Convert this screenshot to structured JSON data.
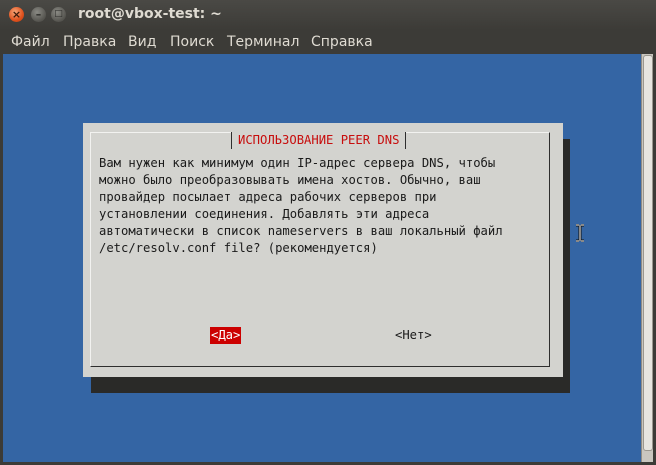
{
  "window": {
    "title": "root@vbox-test: ~",
    "controls": {
      "close": "×",
      "minimize": "–",
      "maximize": "□"
    }
  },
  "menu": [
    {
      "label": "Файл"
    },
    {
      "label": "Правка"
    },
    {
      "label": "Вид"
    },
    {
      "label": "Поиск"
    },
    {
      "label": "Терминал"
    },
    {
      "label": "Справка"
    }
  ],
  "dialog": {
    "title": "ИСПОЛЬЗОВАНИЕ PEER DNS",
    "message": "Вам нужен как минимум один IP-адрес сервера DNS, чтобы\nможно было преобразовывать имена хостов. Обычно, ваш\nпровайдер посылает адреса рабочих серверов при\nустановлении соединения. Добавлять эти адреса\nавтоматически в список nameservers в ваш локальный файл\n/etc/resolv.conf file? (рекомендуется)",
    "yes_label": "<Да>",
    "no_label": "<Нет>"
  },
  "colors": {
    "terminal_bg": "#3465a4",
    "dialog_bg": "#d3d3cf",
    "title_text": "#c70d0d",
    "selected_button": "#cc0000",
    "window_chrome": "#3c3b37"
  },
  "icons": {
    "cursor": "ibeam-cursor-icon"
  }
}
